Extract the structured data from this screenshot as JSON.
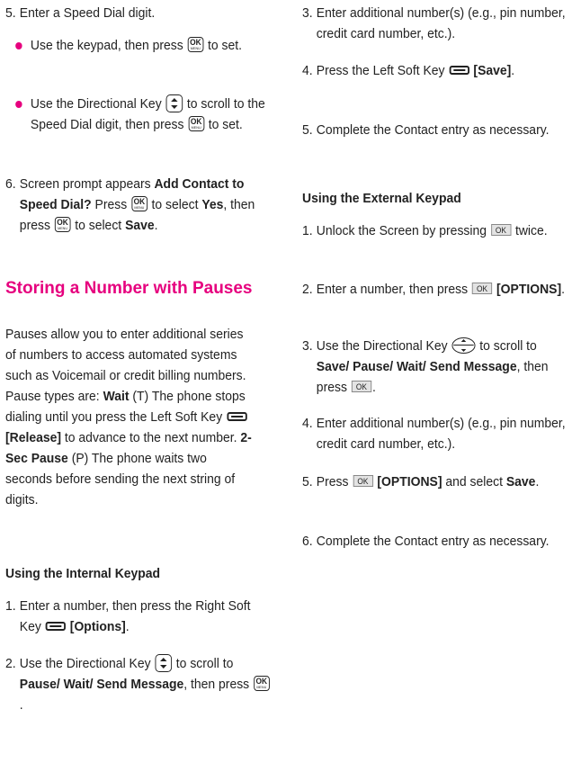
{
  "left": {
    "step5": {
      "num": "5.",
      "text": "Enter a Speed Dial digit."
    },
    "bullet1": {
      "t1": "Use the keypad, then press",
      "t2": "to set."
    },
    "bullet2": {
      "t1": "Use the Directional Key",
      "t2": "to scroll to the Speed Dial digit, then press",
      "t3": "to set."
    },
    "step6": {
      "num": "6.",
      "t1": "Screen prompt appears",
      "b1": "Add Contact to Speed Dial?",
      "t2": "Press",
      "t3": "to select",
      "b2": "Yes",
      "t4": ", then press",
      "t5": "to select",
      "b3": "Save",
      "t6": "."
    },
    "heading": "Storing a Number with Pauses",
    "intro": {
      "t1": "Pauses allow you to enter additional series of numbers to access automated systems such as Voicemail or credit billing numbers. Pause types are:",
      "b1": "Wait",
      "t2": "(T) The phone stops dialing until you press the Left Soft Key",
      "b2": "[Release]",
      "t3": "to advance to the next number.",
      "b3": "2-Sec Pause",
      "t4": "(P) The phone waits two seconds before sending the next string of digits."
    },
    "subheading": "Using the Internal Keypad",
    "istep1": {
      "num": "1.",
      "t1": "Enter a number, then press the Right Soft Key",
      "b1": "[Options]",
      "t2": "."
    },
    "istep2": {
      "num": "2.",
      "t1": "Use the Directional Key",
      "t2": "to scroll to",
      "b1": "Pause/ Wait/ Send Message",
      "t3": ", then press",
      "t4": "."
    }
  },
  "right": {
    "istep3": {
      "num": "3.",
      "text": "Enter additional number(s) (e.g., pin number, credit card number, etc.)."
    },
    "istep4": {
      "num": "4.",
      "t1": "Press the Left Soft Key",
      "b1": "[Save]",
      "t2": "."
    },
    "istep5": {
      "num": "5.",
      "text": "Complete the Contact entry as necessary."
    },
    "subheading": "Using the External Keypad",
    "estep1": {
      "num": "1.",
      "t1": "Unlock the Screen by pressing",
      "t2": "twice."
    },
    "estep2": {
      "num": "2.",
      "t1": "Enter a number, then press",
      "b1": "[OPTIONS]",
      "t2": "."
    },
    "estep3": {
      "num": "3.",
      "t1": "Use the Directional Key",
      "t2": "to scroll to",
      "b1": "Save/ Pause/ Wait/ Send Message",
      "t3": ", then press",
      "t4": "."
    },
    "estep4": {
      "num": "4.",
      "text": "Enter additional number(s) (e.g., pin number, credit card number, etc.)."
    },
    "estep5": {
      "num": "5.",
      "t1": "Press",
      "b1": "[OPTIONS]",
      "t2": "and select",
      "b2": "Save",
      "t3": "."
    },
    "estep6": {
      "num": "6.",
      "text": "Complete the Contact entry as necessary."
    }
  }
}
